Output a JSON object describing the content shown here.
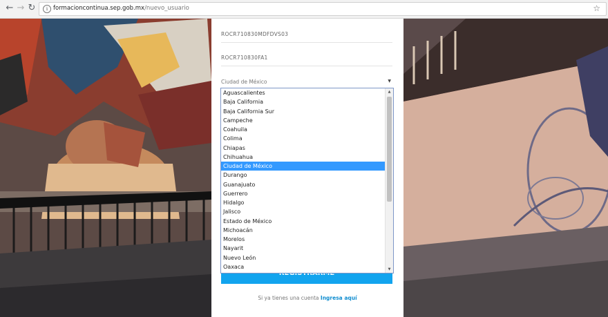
{
  "browser": {
    "url_domain": "formacioncontinua.sep.gob.mx",
    "url_path": "/nuevo_usuario"
  },
  "form": {
    "curp_value": "ROCR710830MDFDVS03",
    "rfc_value": "ROCR710830FA1",
    "state_select": {
      "selected": "Ciudad de México"
    },
    "submit_label": "REGISTRARME",
    "footer_text": "Si ya tienes una cuenta",
    "footer_link": "Ingresa aquí"
  },
  "dropdown": {
    "options": [
      "Aguascalientes",
      "Baja California",
      "Baja California Sur",
      "Campeche",
      "Coahuila",
      "Colima",
      "Chiapas",
      "Chihuahua",
      "Ciudad de México",
      "Durango",
      "Guanajuato",
      "Guerrero",
      "Hidalgo",
      "Jalisco",
      "Estado de México",
      "Michoacán",
      "Morelos",
      "Nayarit",
      "Nuevo León",
      "Oaxaca"
    ],
    "selected_index": 8
  },
  "colors": {
    "accent": "#12a4ee",
    "selected_option": "#3399ff",
    "link": "#128ed0"
  }
}
